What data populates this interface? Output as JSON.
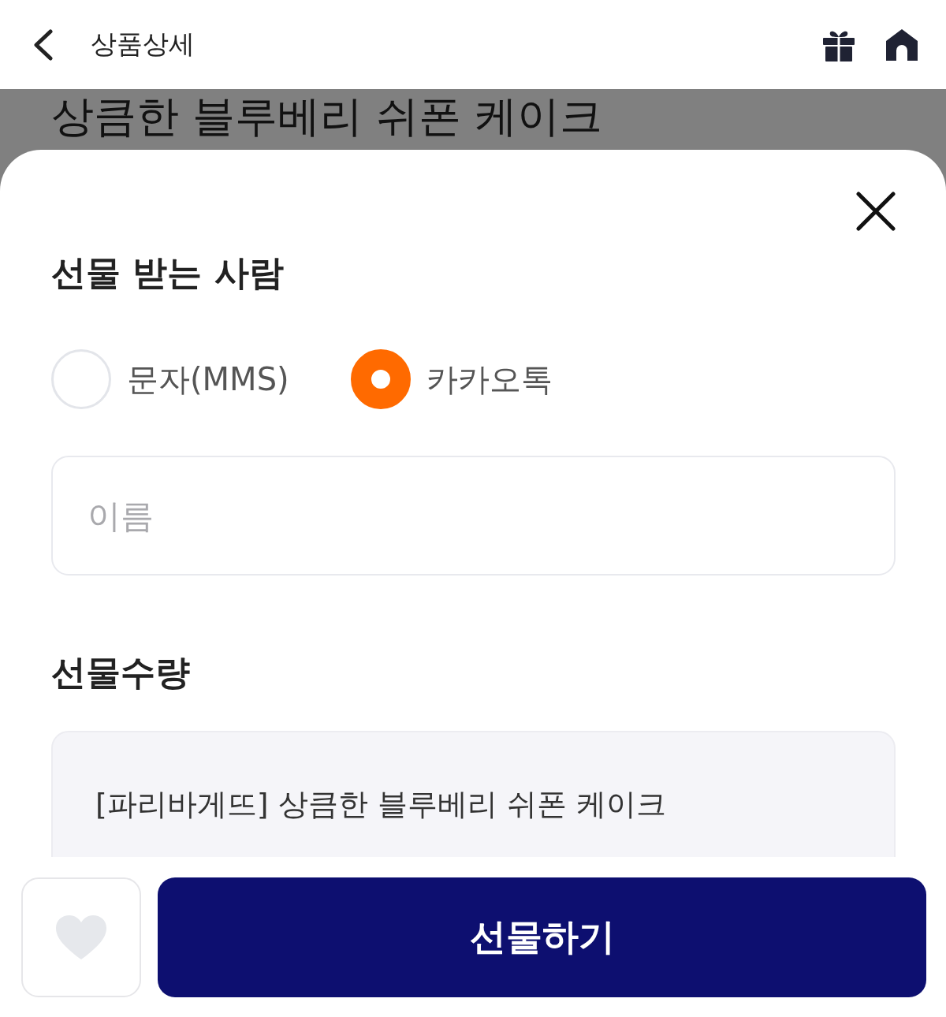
{
  "header": {
    "title": "상품상세"
  },
  "background_page": {
    "product_title": "상큼한 블루베리 쉬폰 케이크"
  },
  "sheet": {
    "recipient": {
      "title": "선물 받는 사람",
      "options": [
        {
          "label": "문자(MMS)",
          "selected": false
        },
        {
          "label": "카카오톡",
          "selected": true
        }
      ],
      "name_field": {
        "placeholder": "이름"
      }
    },
    "quantity": {
      "title": "선물수량",
      "product_name": "[파리바게뜨] 상큼한 블루베리 쉬폰 케이크"
    }
  },
  "bottom_bar": {
    "favorite": {
      "liked": false
    },
    "gift_button": "선물하기"
  }
}
